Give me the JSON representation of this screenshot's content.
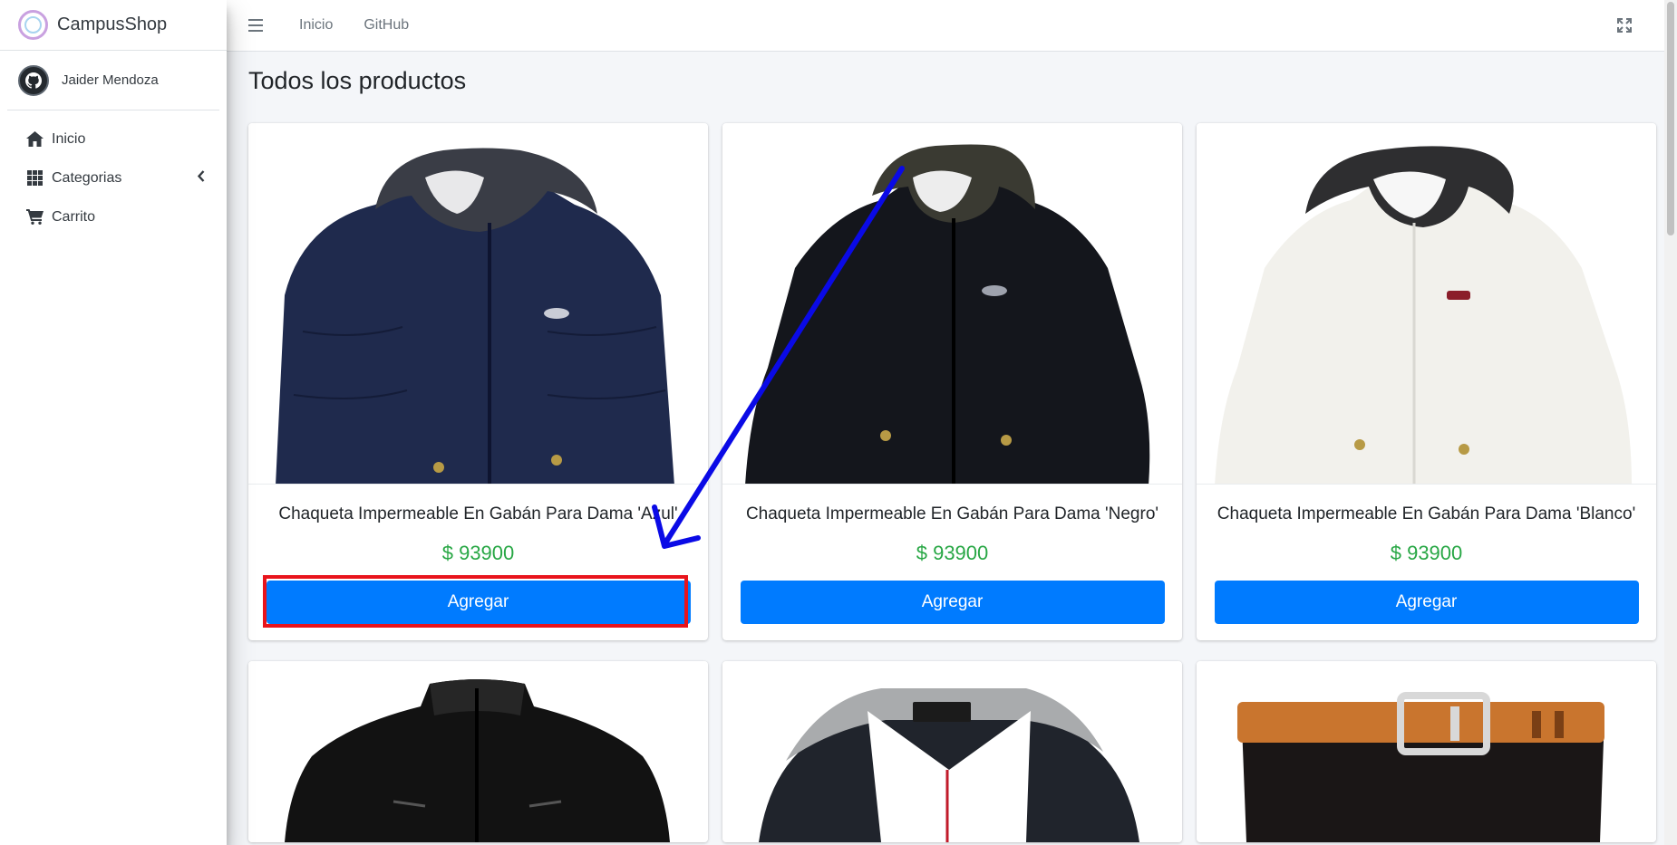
{
  "sidebar": {
    "brand": "CampusShop",
    "user": "Jaider Mendoza",
    "items": [
      {
        "label": "Inicio",
        "icon": "home-icon"
      },
      {
        "label": "Categorias",
        "icon": "grid-icon"
      },
      {
        "label": "Carrito",
        "icon": "cart-icon"
      }
    ]
  },
  "topbar": {
    "links": [
      "Inicio",
      "GitHub"
    ]
  },
  "main": {
    "title": "Todos los productos",
    "products": [
      {
        "name": "Chaqueta Impermeable En Gabán Para Dama 'Azul'",
        "price": "$ 93900",
        "button": "Agregar",
        "color": "#1f2a4d"
      },
      {
        "name": "Chaqueta Impermeable En Gabán Para Dama 'Negro'",
        "price": "$ 93900",
        "button": "Agregar",
        "color": "#14161c"
      },
      {
        "name": "Chaqueta Impermeable En Gabán Para Dama 'Blanco'",
        "price": "$ 93900",
        "button": "Agregar",
        "color": "#f2f1ec"
      }
    ]
  },
  "colors": {
    "primary": "#007bff",
    "price": "#28a745",
    "annotation_box": "#e8141c",
    "annotation_arrow": "#0a0ae6"
  }
}
